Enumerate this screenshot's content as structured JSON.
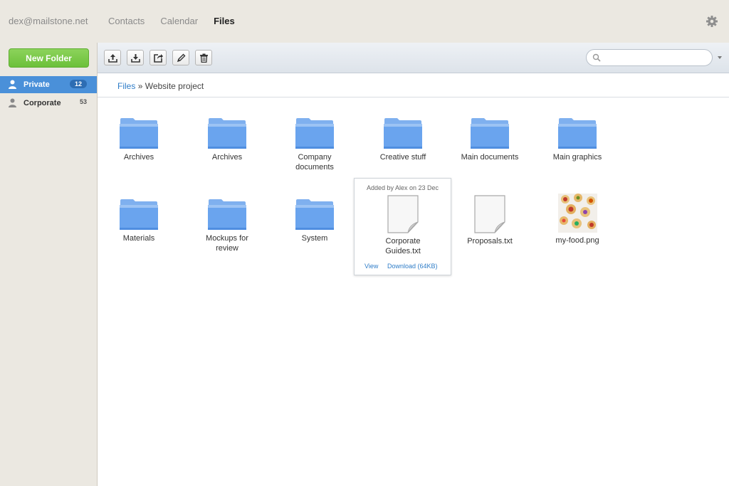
{
  "header": {
    "account": "dex@mailstone.net",
    "nav": [
      {
        "label": "Contacts",
        "active": false
      },
      {
        "label": "Calendar",
        "active": false
      },
      {
        "label": "Files",
        "active": true
      }
    ],
    "settings_icon": "gear-icon"
  },
  "sidebar": {
    "new_folder_label": "New Folder",
    "items": [
      {
        "label": "Private",
        "count": "12",
        "icon": "user-icon",
        "active": true
      },
      {
        "label": "Corporate",
        "count": "53",
        "icon": "user-icon",
        "active": false
      }
    ]
  },
  "toolbar": {
    "buttons": [
      "upload-icon",
      "download-icon",
      "share-icon",
      "edit-icon",
      "trash-icon"
    ],
    "search_placeholder": ""
  },
  "breadcrumb": {
    "root": "Files",
    "separator": "»",
    "current": "Website project"
  },
  "items": [
    {
      "name": "Archives",
      "type": "folder"
    },
    {
      "name": "Archives",
      "type": "folder"
    },
    {
      "name": "Company documents",
      "type": "folder"
    },
    {
      "name": "Creative stuff",
      "type": "folder"
    },
    {
      "name": "Main documents",
      "type": "folder"
    },
    {
      "name": "Main graphics",
      "type": "folder"
    },
    {
      "name": "Materials",
      "type": "folder"
    },
    {
      "name": "Mockups for review",
      "type": "folder"
    },
    {
      "name": "System",
      "type": "folder"
    },
    {
      "name": "Corporate Guides.txt",
      "type": "file",
      "selected": true
    },
    {
      "name": "Proposals.txt",
      "type": "file"
    },
    {
      "name": "my-food.png",
      "type": "image"
    }
  ],
  "popup": {
    "added": "Added by Alex on 23 Dec",
    "view": "View",
    "download": "Download (64KB)"
  },
  "colors": {
    "accent": "#4a90d9",
    "new_folder": "#7cc84b",
    "link": "#2f7dc8",
    "folder": "#6aa4ee"
  }
}
